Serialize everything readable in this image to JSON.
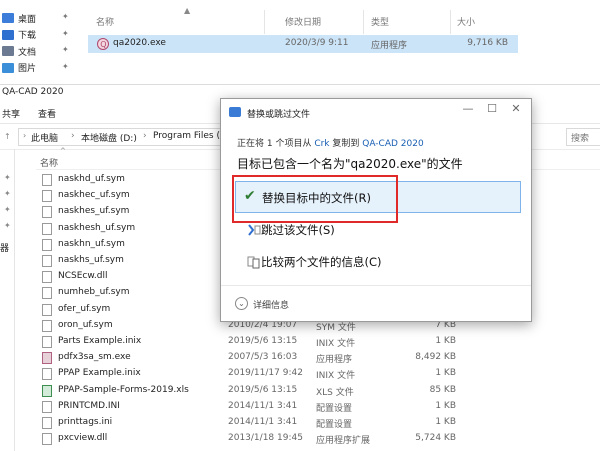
{
  "back_window": {
    "nav": [
      {
        "label": "桌面",
        "icon": "desktop-icon",
        "color": "#3b7dd8"
      },
      {
        "label": "下载",
        "icon": "download-icon",
        "color": "#2f6fd0"
      },
      {
        "label": "文档",
        "icon": "document-icon",
        "color": "#6b7a90"
      },
      {
        "label": "图片",
        "icon": "picture-icon",
        "color": "#3b8fd8"
      }
    ],
    "columns": {
      "name": "名称",
      "date": "修改日期",
      "type": "类型",
      "size": "大小"
    },
    "file": {
      "name": "qa2020.exe",
      "date": "2020/3/9 9:11",
      "type": "应用程序",
      "size": "9,716 KB"
    }
  },
  "front_window": {
    "title": "QA-CAD 2020",
    "ribbon": {
      "share": "共享",
      "view": "查看"
    },
    "breadcrumb": [
      "此电脑",
      "本地磁盘 (D:)",
      "Program Files (x86)"
    ],
    "search_placeholder": "搜索",
    "column_name": "名称",
    "nav_cut_label": "器"
  },
  "files": [
    {
      "name": "naskhd_uf.sym",
      "date": "",
      "type": "",
      "size": "",
      "kind": "doc"
    },
    {
      "name": "naskhec_uf.sym",
      "date": "",
      "type": "",
      "size": "",
      "kind": "doc"
    },
    {
      "name": "naskhes_uf.sym",
      "date": "",
      "type": "",
      "size": "",
      "kind": "doc"
    },
    {
      "name": "naskhesh_uf.sym",
      "date": "",
      "type": "",
      "size": "",
      "kind": "doc"
    },
    {
      "name": "naskhn_uf.sym",
      "date": "",
      "type": "",
      "size": "",
      "kind": "doc"
    },
    {
      "name": "naskhs_uf.sym",
      "date": "",
      "type": "",
      "size": "",
      "kind": "doc"
    },
    {
      "name": "NCSEcw.dll",
      "date": "",
      "type": "",
      "size": "",
      "kind": "doc"
    },
    {
      "name": "numheb_uf.sym",
      "date": "",
      "type": "",
      "size": "",
      "kind": "doc"
    },
    {
      "name": "ofer_uf.sym",
      "date": "",
      "type": "",
      "size": "",
      "kind": "doc"
    },
    {
      "name": "oron_uf.sym",
      "date": "2010/2/4 19:07",
      "type": "SYM 文件",
      "size": "7 KB",
      "kind": "doc"
    },
    {
      "name": "Parts Example.inix",
      "date": "2019/5/6 13:15",
      "type": "INIX 文件",
      "size": "1 KB",
      "kind": "doc"
    },
    {
      "name": "pdfx3sa_sm.exe",
      "date": "2007/5/3 16:03",
      "type": "应用程序",
      "size": "8,492 KB",
      "kind": "exe"
    },
    {
      "name": "PPAP Example.inix",
      "date": "2019/11/17 9:42",
      "type": "INIX 文件",
      "size": "1 KB",
      "kind": "doc"
    },
    {
      "name": "PPAP-Sample-Forms-2019.xls",
      "date": "2019/5/6 13:15",
      "type": "XLS 文件",
      "size": "85 KB",
      "kind": "xls"
    },
    {
      "name": "PRINTCMD.INI",
      "date": "2014/11/1 3:41",
      "type": "配置设置",
      "size": "1 KB",
      "kind": "doc"
    },
    {
      "name": "printtags.ini",
      "date": "2014/11/1 3:41",
      "type": "配置设置",
      "size": "1 KB",
      "kind": "doc"
    },
    {
      "name": "pxcview.dll",
      "date": "2013/1/18 19:45",
      "type": "应用程序扩展",
      "size": "5,724 KB",
      "kind": "doc"
    }
  ],
  "dialog": {
    "title": "替换或跳过文件",
    "line1_prefix": "正在将 1 个项目从 ",
    "line1_src": "Crk",
    "line1_mid": " 复制到 ",
    "line1_dst": "QA-CAD 2020",
    "line2": "目标已包含一个名为\"qa2020.exe\"的文件",
    "replace": "替换目标中的文件(R)",
    "skip": "跳过该文件(S)",
    "compare": "比较两个文件的信息(C)",
    "details": "详细信息",
    "accent": "#e02a2a"
  }
}
